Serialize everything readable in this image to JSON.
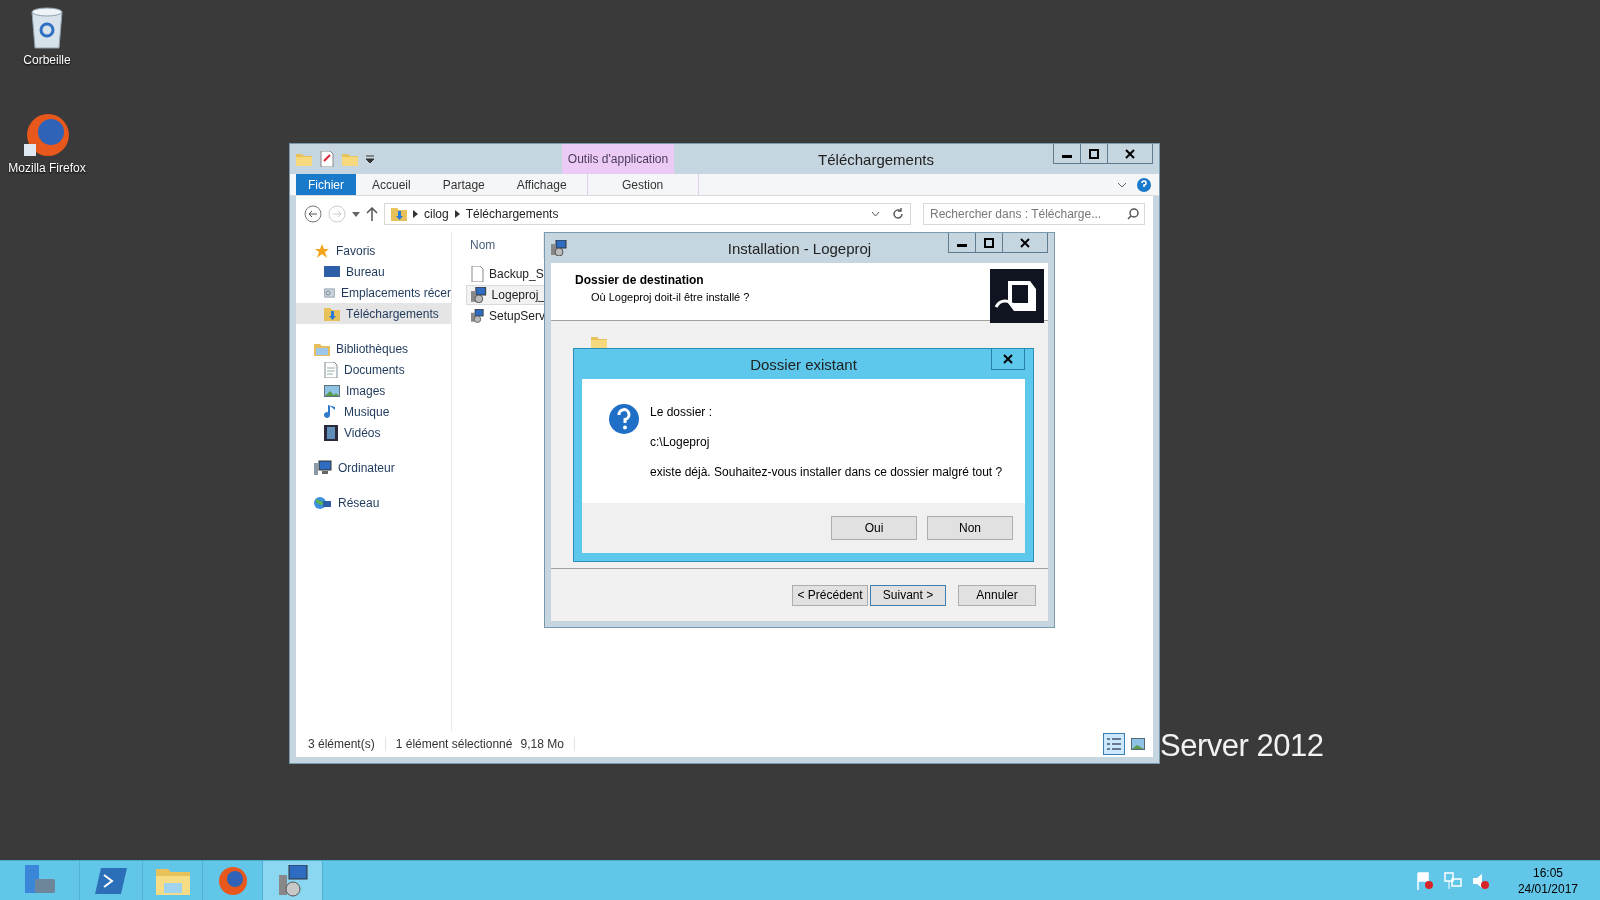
{
  "desktop": {
    "icons": [
      {
        "label": "Corbeille"
      },
      {
        "label": "Mozilla Firefox"
      }
    ],
    "wallpaper_text": "Server 2012"
  },
  "explorer": {
    "contextual_group": "Outils d'application",
    "title": "Téléchargements",
    "ribbon_tabs": [
      {
        "label": "Fichier",
        "kind": "file"
      },
      {
        "label": "Accueil",
        "kind": "tab"
      },
      {
        "label": "Partage",
        "kind": "tab"
      },
      {
        "label": "Affichage",
        "kind": "tab"
      },
      {
        "label": "Gestion",
        "kind": "contextual"
      }
    ],
    "breadcrumbs": [
      "cilog",
      "Téléchargements"
    ],
    "search": {
      "placeholder": "Rechercher dans : Télécharge..."
    },
    "nav": [
      {
        "label": "Favoris",
        "selected": false,
        "children": [
          {
            "label": "Bureau",
            "selected": false
          },
          {
            "label": "Emplacements récer",
            "selected": false
          },
          {
            "label": "Téléchargements",
            "selected": true
          }
        ]
      },
      {
        "label": "Bibliothèques",
        "selected": false,
        "children": [
          {
            "label": "Documents",
            "selected": false
          },
          {
            "label": "Images",
            "selected": false
          },
          {
            "label": "Musique",
            "selected": false
          },
          {
            "label": "Vidéos",
            "selected": false
          }
        ]
      },
      {
        "label": "Ordinateur",
        "selected": false
      },
      {
        "label": "Réseau",
        "selected": false
      }
    ],
    "column_header": "Nom",
    "files": [
      {
        "name": "Backup_S",
        "selected": false
      },
      {
        "name": "Logeproj_",
        "selected": true
      },
      {
        "name": "SetupServ",
        "selected": false
      }
    ],
    "status": {
      "count": "3 élément(s)",
      "selection": "1 élément sélectionné",
      "size": "9,18 Mo"
    },
    "views": [
      {
        "selected": true
      },
      {
        "selected": false
      }
    ]
  },
  "installer": {
    "title": "Installation - Logeproj",
    "heading": "Dossier de destination",
    "subheading": "Où Logeproj doit-il être installé ?",
    "buttons": [
      "< Précédent",
      "Suivant >",
      "Annuler"
    ]
  },
  "message_box": {
    "title": "Dossier existant",
    "lines": [
      "Le dossier :",
      "c:\\Logeproj",
      "existe déjà. Souhaitez-vous installer dans ce dossier malgré tout ?"
    ],
    "buttons": [
      "Oui",
      "Non"
    ]
  },
  "taskbar": {
    "items": [
      {
        "selected": false
      },
      {
        "selected": false
      },
      {
        "selected": false
      },
      {
        "selected": false
      },
      {
        "selected": true
      }
    ],
    "time": "16:05",
    "date": "24/01/2017"
  }
}
